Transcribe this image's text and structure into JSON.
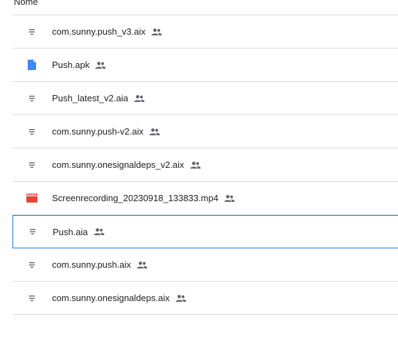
{
  "list": {
    "header": "Nome",
    "files": [
      {
        "name": "com.sunny.push_v3.aix",
        "icon": "generic-file-icon",
        "shared": true,
        "selected": false
      },
      {
        "name": "Push.apk",
        "icon": "document-file-icon",
        "shared": true,
        "selected": false
      },
      {
        "name": "Push_latest_v2.aia",
        "icon": "generic-file-icon",
        "shared": true,
        "selected": false
      },
      {
        "name": "com.sunny.push-v2.aix",
        "icon": "generic-file-icon",
        "shared": true,
        "selected": false
      },
      {
        "name": "com.sunny.onesignaldeps_v2.aix",
        "icon": "generic-file-icon",
        "shared": true,
        "selected": false
      },
      {
        "name": "Screenrecording_20230918_133833.mp4",
        "icon": "video-file-icon",
        "shared": true,
        "selected": false
      },
      {
        "name": "Push.aia",
        "icon": "generic-file-icon",
        "shared": true,
        "selected": true
      },
      {
        "name": "com.sunny.push.aix",
        "icon": "generic-file-icon",
        "shared": true,
        "selected": false
      },
      {
        "name": "com.sunny.onesignaldeps.aix",
        "icon": "generic-file-icon",
        "shared": true,
        "selected": false
      }
    ]
  },
  "colors": {
    "text": "#202124",
    "divider": "#dadce0",
    "selection_border": "#1a73e8",
    "generic_icon": "#5f6368",
    "doc_icon": "#4285f4",
    "video_icon": "#ea4335"
  }
}
